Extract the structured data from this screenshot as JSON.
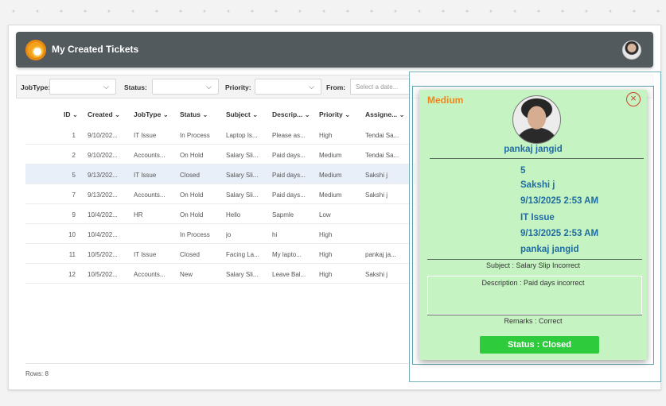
{
  "header": {
    "title": "My Created Tickets"
  },
  "filters": {
    "jobtype_label": "JobType:",
    "status_label": "Status:",
    "priority_label": "Priority:",
    "from_label": "From:",
    "date_placeholder": "Select a date..."
  },
  "grid": {
    "columns": [
      "ID",
      "Created",
      "JobType",
      "Status",
      "Subject",
      "Descrip...",
      "Priority",
      "Assigne..."
    ],
    "rows": [
      [
        "1",
        "9/10/202...",
        "IT Issue",
        "In Process",
        "Laptop Is...",
        "Please as...",
        "High",
        "Tendai Sa..."
      ],
      [
        "2",
        "9/10/202...",
        "Accounts...",
        "On Hold",
        "Salary Sli...",
        "Paid days...",
        "Medium",
        "Tendai Sa..."
      ],
      [
        "5",
        "9/13/202...",
        "IT Issue",
        "Closed",
        "Salary Sli...",
        "Paid days...",
        "Medium",
        "Sakshi j"
      ],
      [
        "7",
        "9/13/202...",
        "Accounts...",
        "On Hold",
        "Salary Sli...",
        "Paid days...",
        "Medium",
        "Sakshi j"
      ],
      [
        "9",
        "10/4/202...",
        "HR",
        "On Hold",
        "Hello",
        "Sapmle",
        "Low",
        ""
      ],
      [
        "10",
        "10/4/202...",
        "",
        "In Process",
        "jo",
        "hi",
        "High",
        ""
      ],
      [
        "11",
        "10/5/202...",
        "IT Issue",
        "Closed",
        "Facing La...",
        "My lapto...",
        "High",
        "pankaj ja..."
      ],
      [
        "12",
        "10/5/202...",
        "Accounts...",
        "New",
        "Salary Sli...",
        "Leave Bal...",
        "High",
        "Sakshi j"
      ]
    ],
    "footer": "Rows: 8"
  },
  "popup": {
    "priority": "Medium",
    "name": "pankaj jangid",
    "details": [
      "5",
      "Sakshi j",
      "9/13/2025 2:53 AM",
      "IT Issue",
      "9/13/2025 2:53 AM",
      "pankaj jangid"
    ],
    "subject": "Subject : Salary Slip Incorrect",
    "description": "Description : Paid days incorrect",
    "remarks": "Remarks : Correct",
    "status": "Status : Closed"
  }
}
